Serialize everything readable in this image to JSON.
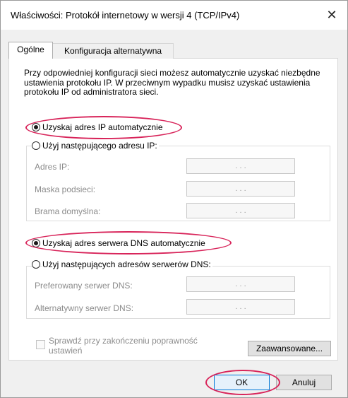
{
  "window": {
    "title": "Właściwości: Protokół internetowy w wersji 4 (TCP/IPv4)",
    "close_glyph": "✕"
  },
  "tabs": [
    {
      "label": "Ogólne",
      "active": true
    },
    {
      "label": "Konfiguracja alternatywna",
      "active": false
    }
  ],
  "description": "Przy odpowiedniej konfiguracji sieci możesz automatycznie uzyskać niezbędne ustawienia protokołu IP. W przeciwnym wypadku musisz uzyskać ustawienia protokołu IP od administratora sieci.",
  "ip": {
    "auto_label": "Uzyskaj adres IP automatycznie",
    "auto_selected": true,
    "manual_label": "Użyj następującego adresu IP:",
    "fields": [
      {
        "label": "Adres IP:",
        "value": ".       .       ."
      },
      {
        "label": "Maska podsieci:",
        "value": ".       .       ."
      },
      {
        "label": "Brama domyślna:",
        "value": ".       .       ."
      }
    ]
  },
  "dns": {
    "auto_label": "Uzyskaj adres serwera DNS automatycznie",
    "auto_selected": true,
    "manual_label": "Użyj następujących adresów serwerów DNS:",
    "fields": [
      {
        "label": "Preferowany serwer DNS:",
        "value": ".       .       ."
      },
      {
        "label": "Alternatywny serwer DNS:",
        "value": ".       .       ."
      }
    ]
  },
  "validate_checkbox": {
    "label": "Sprawdź przy zakończeniu poprawność ustawień",
    "checked": false,
    "enabled": false
  },
  "buttons": {
    "advanced": "Zaawansowane...",
    "ok": "OK",
    "cancel": "Anuluj"
  },
  "colors": {
    "highlight_ring": "#d8245a",
    "ok_border": "#0078d7"
  }
}
